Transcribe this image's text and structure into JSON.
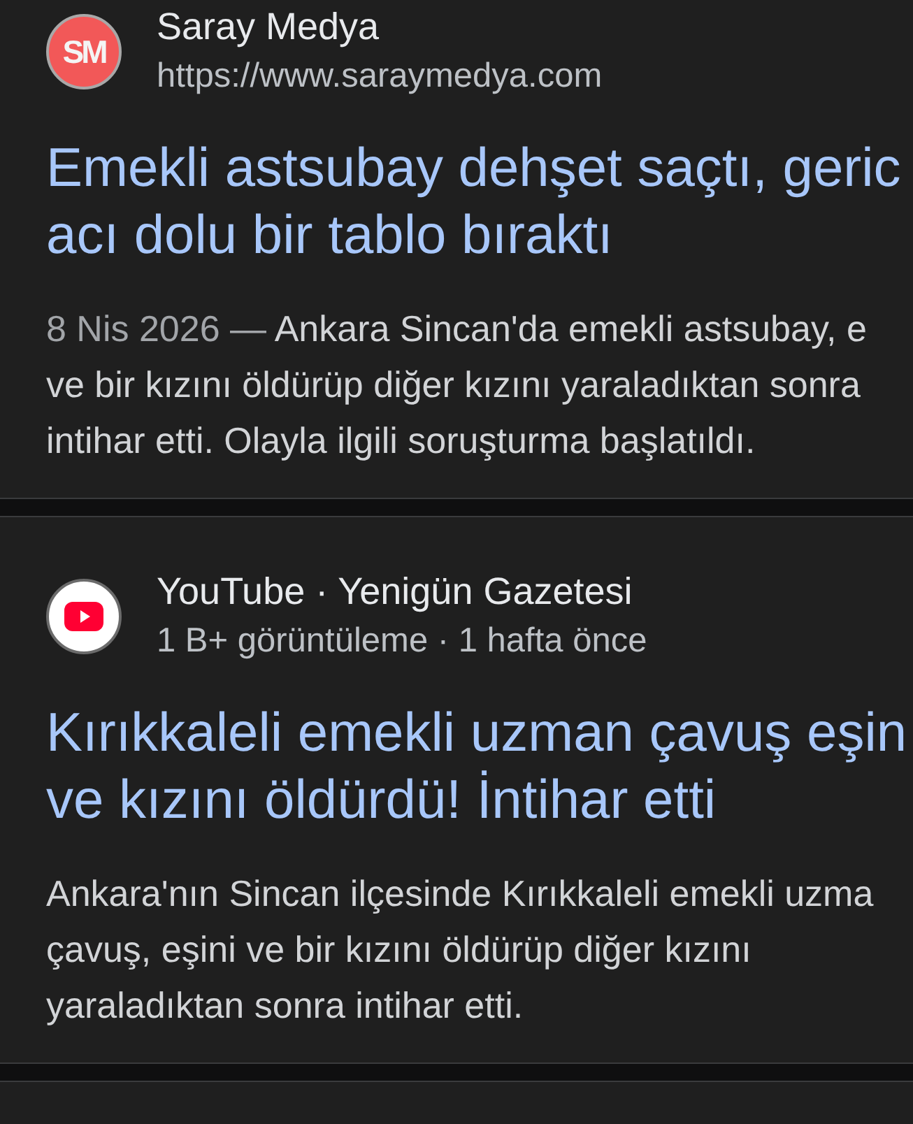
{
  "results": [
    {
      "logo": {
        "kind": "monogram",
        "text": "SM"
      },
      "source": "Saray Medya",
      "url": "https://www.saraymedya.com",
      "title": [
        "Emekli astsubay dehşet saçtı, geric",
        "acı dolu bir tablo bıraktı"
      ],
      "snippet": {
        "date": "8 Nis 2026 —",
        "lines": [
          "Ankara Sincan'da emekli astsubay, e",
          "ve bir kızını öldürüp diğer kızını yaraladıktan sonra",
          "intihar etti. Olayla ilgili soruşturma başlatıldı."
        ]
      }
    },
    {
      "logo": {
        "kind": "video"
      },
      "source": "YouTube · Yenigün Gazetesi",
      "video_info": "1 B+ görüntüleme · 1 hafta önce",
      "title": [
        "Kırıkkaleli emekli uzman çavuş eşin",
        "ve kızını öldürdü! İntihar etti"
      ],
      "snippet": {
        "lines": [
          "Ankara'nın Sincan ilçesinde Kırıkkaleli emekli uzma",
          "çavuş, eşini ve bir kızını öldürüp diğer kızını",
          "yaraladıktan sonra intihar etti."
        ]
      }
    }
  ]
}
